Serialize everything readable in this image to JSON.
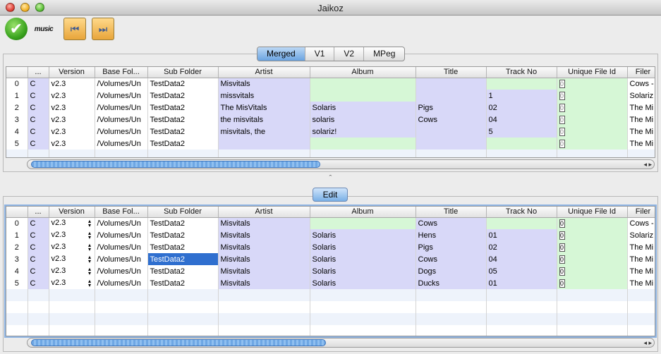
{
  "window": {
    "title": "Jaikoz"
  },
  "toolbar": {
    "ok_label": "✔",
    "musicbrainz_label": "music",
    "prev_label": "⏮",
    "next_label": "⏭"
  },
  "tabs": [
    {
      "label": "Merged",
      "active": true
    },
    {
      "label": "V1",
      "active": false
    },
    {
      "label": "V2",
      "active": false
    },
    {
      "label": "MPeg",
      "active": false
    }
  ],
  "edit": {
    "label": "Edit"
  },
  "splitter": {
    "label": "ˆ"
  },
  "columns": [
    "",
    "...",
    "Version",
    "Base Fol...",
    "Sub Folder",
    "Artist",
    "Album",
    "Title",
    "Track No",
    "Unique File Id",
    "Filer"
  ],
  "merged_rows": [
    [
      "0",
      "C",
      "v2.3",
      "/Volumes/Un",
      "TestData2",
      "Misvitals",
      "",
      "",
      "",
      "0",
      "Cows -"
    ],
    [
      "1",
      "C",
      "v2.3",
      "/Volumes/Un",
      "TestData2",
      "missvitals",
      "",
      "",
      "1",
      "0",
      "Solariz"
    ],
    [
      "2",
      "C",
      "v2.3",
      "/Volumes/Un",
      "TestData2",
      "The MisVitals",
      "Solaris",
      "Pigs",
      "02",
      "0",
      "The Mi"
    ],
    [
      "3",
      "C",
      "v2.3",
      "/Volumes/Un",
      "TestData2",
      "the misvitals",
      "solaris",
      "Cows",
      "04",
      "0",
      "The Mi"
    ],
    [
      "4",
      "C",
      "v2.3",
      "/Volumes/Un",
      "TestData2",
      "misvitals, the",
      "solariz!",
      "",
      "5",
      "0",
      "The Mi"
    ],
    [
      "5",
      "C",
      "v2.3",
      "/Volumes/Un",
      "TestData2",
      "",
      "",
      "",
      "",
      "0",
      "The Mi"
    ]
  ],
  "edit_rows": [
    [
      "0",
      "C",
      "v2.3",
      "/Volumes/Un",
      "TestData2",
      "Misvitals",
      "",
      "Cows",
      "",
      "0",
      "Cows -"
    ],
    [
      "1",
      "C",
      "v2.3",
      "/Volumes/Un",
      "TestData2",
      "Misvitals",
      "Solaris",
      "Hens",
      "01",
      "0",
      "Solariz"
    ],
    [
      "2",
      "C",
      "v2.3",
      "/Volumes/Un",
      "TestData2",
      "Misvitals",
      "Solaris",
      "Pigs",
      "02",
      "0",
      "The Mi"
    ],
    [
      "3",
      "C",
      "v2.3",
      "/Volumes/Un",
      "TestData2",
      "Misvitals",
      "Solaris",
      "Cows",
      "04",
      "0",
      "The Mi"
    ],
    [
      "4",
      "C",
      "v2.3",
      "/Volumes/Un",
      "TestData2",
      "Misvitals",
      "Solaris",
      "Dogs",
      "05",
      "0",
      "The Mi"
    ],
    [
      "5",
      "C",
      "v2.3",
      "/Volumes/Un",
      "TestData2",
      "Misvitals",
      "Solaris",
      "Ducks",
      "01",
      "0",
      "The Mi"
    ]
  ],
  "colors": {
    "lavender": "#d8d8f8",
    "green": "#d6f7d6",
    "selection": "#2f6fcf",
    "tab_active": "#6aa3e0"
  }
}
